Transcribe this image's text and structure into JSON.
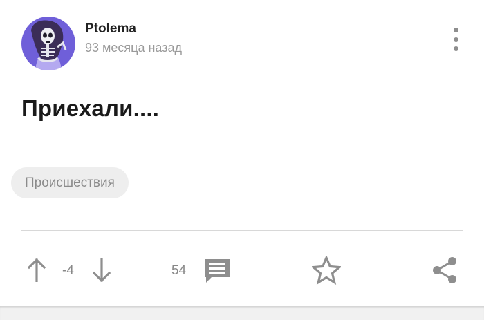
{
  "author": {
    "name": "Ptolema",
    "time_ago": "93 месяца назад",
    "avatar_icon": "skeleton-avatar-icon"
  },
  "post": {
    "title": "Приехали....",
    "tag": "Происшествия"
  },
  "actions": {
    "rating": "-4",
    "comments_count": "54",
    "upvote_icon": "arrow-up-icon",
    "downvote_icon": "arrow-down-icon",
    "comment_icon": "comment-icon",
    "favorite_icon": "star-icon",
    "share_icon": "share-icon",
    "menu_icon": "more-vertical-icon"
  },
  "colors": {
    "avatar_bg": "#6f5fd9",
    "icon_gray": "#8e8e8e",
    "chip_bg": "#eeeeee"
  }
}
